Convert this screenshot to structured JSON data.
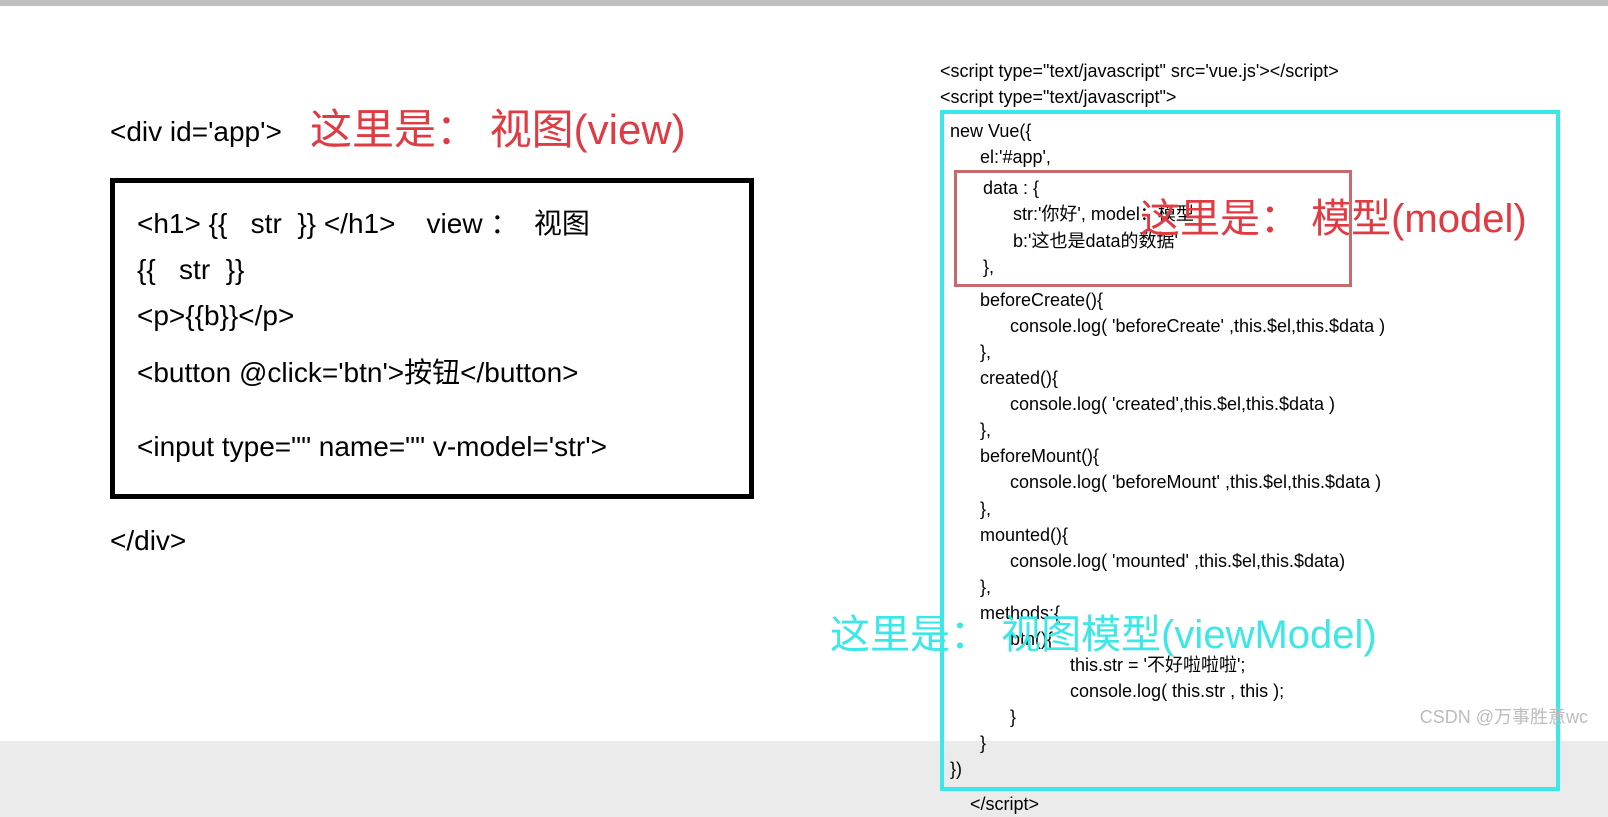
{
  "left": {
    "divOpen": "<div id='app'>",
    "viewLabel": "这里是： 视图(view)",
    "line1": "<h1> {{   str  }} </h1>    view ：  视图",
    "line2": "{{   str  }}",
    "line3": "<p>{{b}}</p>",
    "line4": "<button @click='btn'>按钮</button>",
    "line5": "<input type=\"\" name=\"\" v-model='str'>",
    "divClose": "</div>"
  },
  "right": {
    "scriptSrc": "<script type=\"text/javascript\" src='vue.js'></script>",
    "scriptOpen": "<script type=\"text/javascript\">",
    "newVue": "new Vue({",
    "el": "el:'#app',",
    "dataOpen": "data : {",
    "dataStr": "str:'你好',   model：模型",
    "dataB": "b:'这也是data的数据'",
    "dataClose": "},",
    "beforeCreateOpen": "beforeCreate(){",
    "beforeCreateLog": "console.log(  'beforeCreate' ,this.$el,this.$data )",
    "close1": "},",
    "createdOpen": "created(){",
    "createdLog": "console.log(  'created',this.$el,this.$data  )",
    "close2": "},",
    "beforeMountOpen": "beforeMount(){",
    "beforeMountLog": "console.log(  'beforeMount' ,this.$el,this.$data )",
    "close3": "},",
    "mountedOpen": "mounted(){",
    "mountedLog": "console.log(  'mounted' ,this.$el,this.$data)",
    "close4": "},",
    "methodsOpen": "methods:{",
    "btnOpen": "btn(){",
    "btnLine1": "this.str = '不好啦啦啦';",
    "btnLine2": "console.log(  this.str  , this );",
    "btnClose": "}",
    "methodsClose": "}",
    "vueClose": "})",
    "scriptClose": "</script>",
    "modelLabel": "这里是： 模型(model)",
    "vmLabel": "这里是： 视图模型(viewModel)"
  },
  "watermark": "CSDN @万事胜意wc"
}
